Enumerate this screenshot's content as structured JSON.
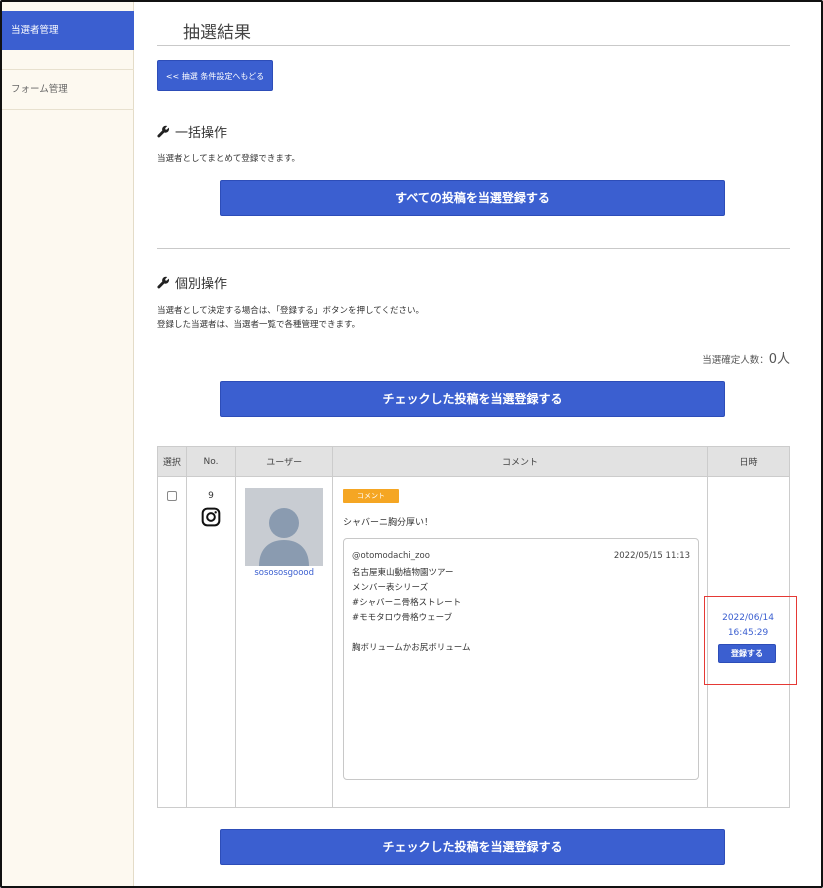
{
  "sidebar": {
    "items": [
      {
        "label": "当選者管理"
      },
      {
        "label": "フォーム管理"
      }
    ]
  },
  "page": {
    "title": "抽選結果",
    "back_button": "<< 抽選 条件設定へもどる"
  },
  "bulk": {
    "title": "一括操作",
    "description": "当選者としてまとめて登録できます。",
    "button": "すべての投稿を当選登録する"
  },
  "individual": {
    "title": "個別操作",
    "desc_line1": "当選者として決定する場合は、「登録する」ボタンを押してください。",
    "desc_line2": "登録した当選者は、当選者一覧で各種管理できます。",
    "count_label": "当選確定人数：",
    "count_value": "0人",
    "button_top": "チェックした投稿を当選登録する",
    "button_bottom": "チェックした投稿を当選登録する"
  },
  "table": {
    "headers": [
      "選択",
      "No.",
      "ユーザー",
      "コメント",
      "日時"
    ],
    "rows": [
      {
        "no": "9",
        "platform_icon": "instagram-icon",
        "username": "sosososgoood",
        "tag": "コメント",
        "comment": "シャバーニ胸分厚い！",
        "post": {
          "account": "@otomodachi_zoo",
          "posted_at": "2022/05/15 11:13",
          "lines": [
            "名古屋東山動植物園ツアー",
            "メンバー表シリーズ",
            "#シャバーニ骨格ストレート",
            "#モモタロウ骨格ウェーブ",
            "",
            "胸ボリュームかお尻ボリューム"
          ]
        },
        "date": "2022/06/14",
        "time": "16:45:29",
        "register_button": "登録する"
      }
    ]
  },
  "colors": {
    "accent": "#3b5fd0",
    "tag": "#f5a623",
    "highlight": "#e53935",
    "sidebar_bg": "#fdf9f0"
  }
}
